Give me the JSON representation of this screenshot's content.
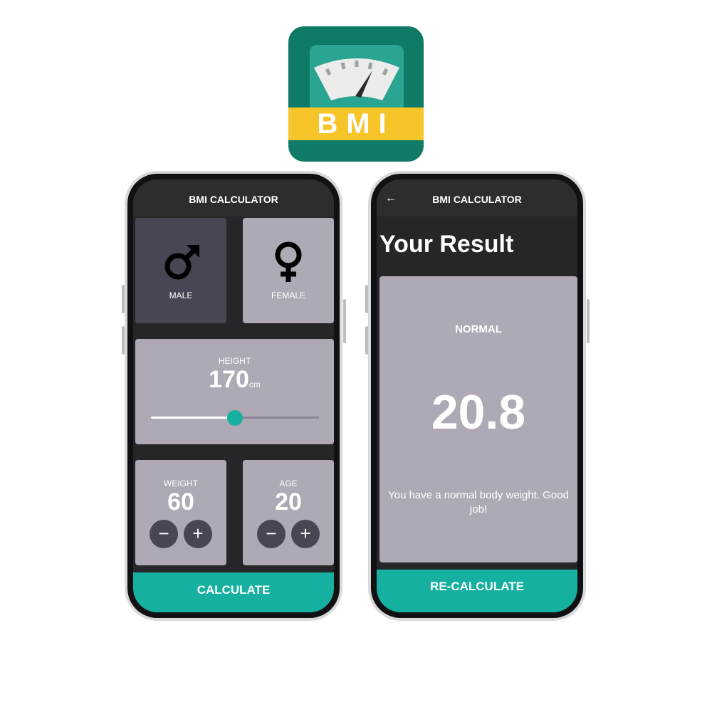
{
  "icon": {
    "band_label": "BMI",
    "colors": {
      "bg": "#0f7a66",
      "band": "#f7c42a",
      "screen": "#2aa591"
    }
  },
  "screen1": {
    "appbar_title": "BMI CALCULATOR",
    "gender": {
      "male": {
        "label": "MALE",
        "icon": "male-symbol-icon",
        "selected": true
      },
      "female": {
        "label": "FEMALE",
        "icon": "female-symbol-icon",
        "selected": false
      }
    },
    "height": {
      "label": "HEIGHT",
      "value": "170",
      "unit": "cm",
      "slider_fraction": 0.5
    },
    "weight": {
      "label": "WEIGHT",
      "value": "60",
      "minus": "−",
      "plus": "+"
    },
    "age": {
      "label": "AGE",
      "value": "20",
      "minus": "−",
      "plus": "+"
    },
    "button": "CALCULATE"
  },
  "screen2": {
    "appbar_title": "BMI CALCULATOR",
    "back_icon": "back-arrow-icon",
    "heading": "Your Result",
    "result_category": "NORMAL",
    "bmi_value": "20.8",
    "message": "You have a normal body weight. Good job!",
    "button": "RE-CALCULATE"
  },
  "colors": {
    "accent": "#16b0a0",
    "card": "#aea9b5",
    "card_selected": "#4a4553",
    "background": "#262629"
  }
}
